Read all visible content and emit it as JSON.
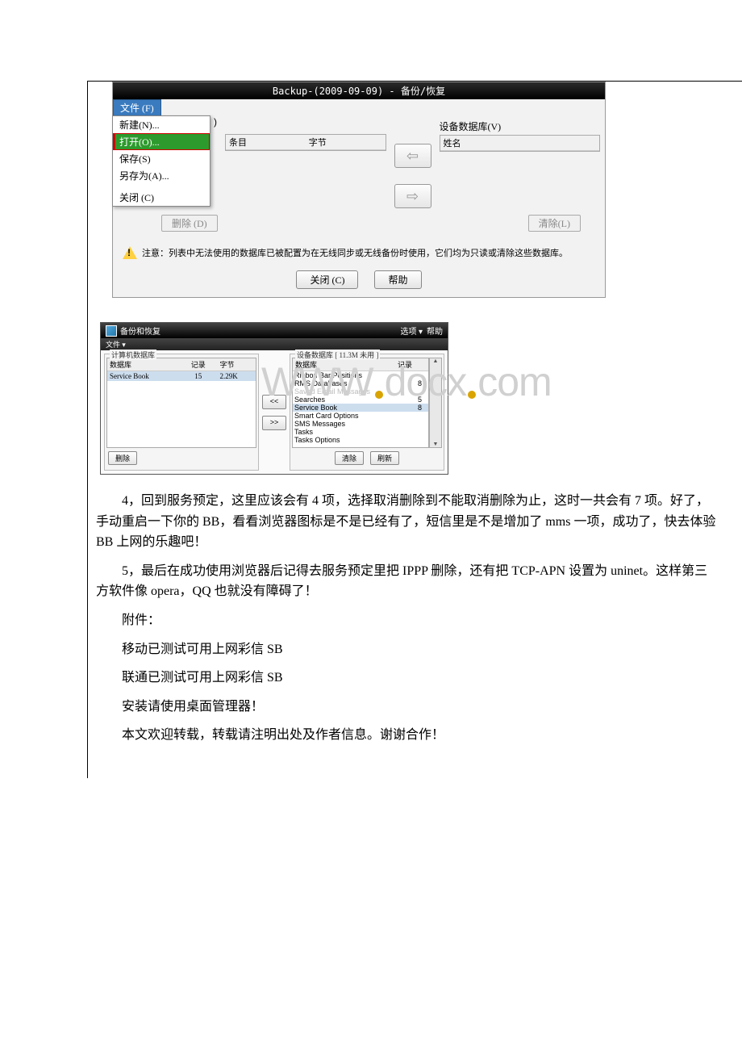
{
  "dialog1": {
    "title": "Backup-(2009-09-09) - 备份/恢复",
    "menu_tab": "文件 (F)",
    "menu_items": {
      "new": "新建(N)...",
      "open": "打开(O)...",
      "save": "保存(S)",
      "saveas": "另存为(A)...",
      "close": "关闭 (C)"
    },
    "stray_paren": ")",
    "left_headers": {
      "a": "条目",
      "b": "字节"
    },
    "right_label": "设备数据库(V)",
    "right_header": "姓名",
    "delete_btn": "删除 (D)",
    "clear_btn": "清除(L)",
    "note": "注意：列表中无法使用的数据库已被配置为在无线同步或无线备份时使用，它们均为只读或清除这些数据库。",
    "close_btn": "关闭 (C)",
    "help_btn": "帮助"
  },
  "dialog2": {
    "title": "备份和恢复",
    "options": "选项 ▾",
    "help": "帮助",
    "file_menu": "文件 ▾",
    "left_legend": "计算机数据库",
    "right_legend": "设备数据库 [ 11.3M 未用 ]",
    "th_db": "数据库",
    "th_rec": "记录",
    "th_bytes": "字节",
    "left_row": {
      "db": "Service Book",
      "rec": "15",
      "bytes": "2.29K"
    },
    "mid_left": "<<",
    "mid_right": ">>",
    "right_rows": [
      {
        "name": "Ribbon Bar Positions",
        "val": ""
      },
      {
        "name": "RMS Databases",
        "val": "8"
      },
      {
        "name": "Saved Email Messages",
        "val": ""
      },
      {
        "name": "Searches",
        "val": "5"
      },
      {
        "name": "Service Book",
        "val": "8"
      },
      {
        "name": "Smart Card Options",
        "val": ""
      },
      {
        "name": "SMS Messages",
        "val": ""
      },
      {
        "name": "Tasks",
        "val": ""
      },
      {
        "name": "Tasks Options",
        "val": ""
      }
    ],
    "btn_delete": "删除",
    "btn_clear": "清除",
    "btn_refresh": "刷新"
  },
  "watermark": {
    "left": "WWW",
    "mid": "docx",
    "right": "com"
  },
  "article": {
    "p4": "4，回到服务预定，这里应该会有 4 项，选择取消删除到不能取消删除为止，这时一共会有 7 项。好了，手动重启一下你的 BB，看看浏览器图标是不是已经有了，短信里是不是增加了 mms 一项，成功了，快去体验 BB 上网的乐趣吧！",
    "p5": "5，最后在成功使用浏览器后记得去服务预定里把 IPPP 删除，还有把 TCP-APN 设置为 uninet。这样第三方软件像 opera，QQ 也就没有障碍了！",
    "p6": "附件：",
    "p7": "移动已测试可用上网彩信 SB",
    "p8": "联通已测试可用上网彩信 SB",
    "p9": "安装请使用桌面管理器！",
    "p10": "本文欢迎转载，转载请注明出处及作者信息。谢谢合作！"
  }
}
